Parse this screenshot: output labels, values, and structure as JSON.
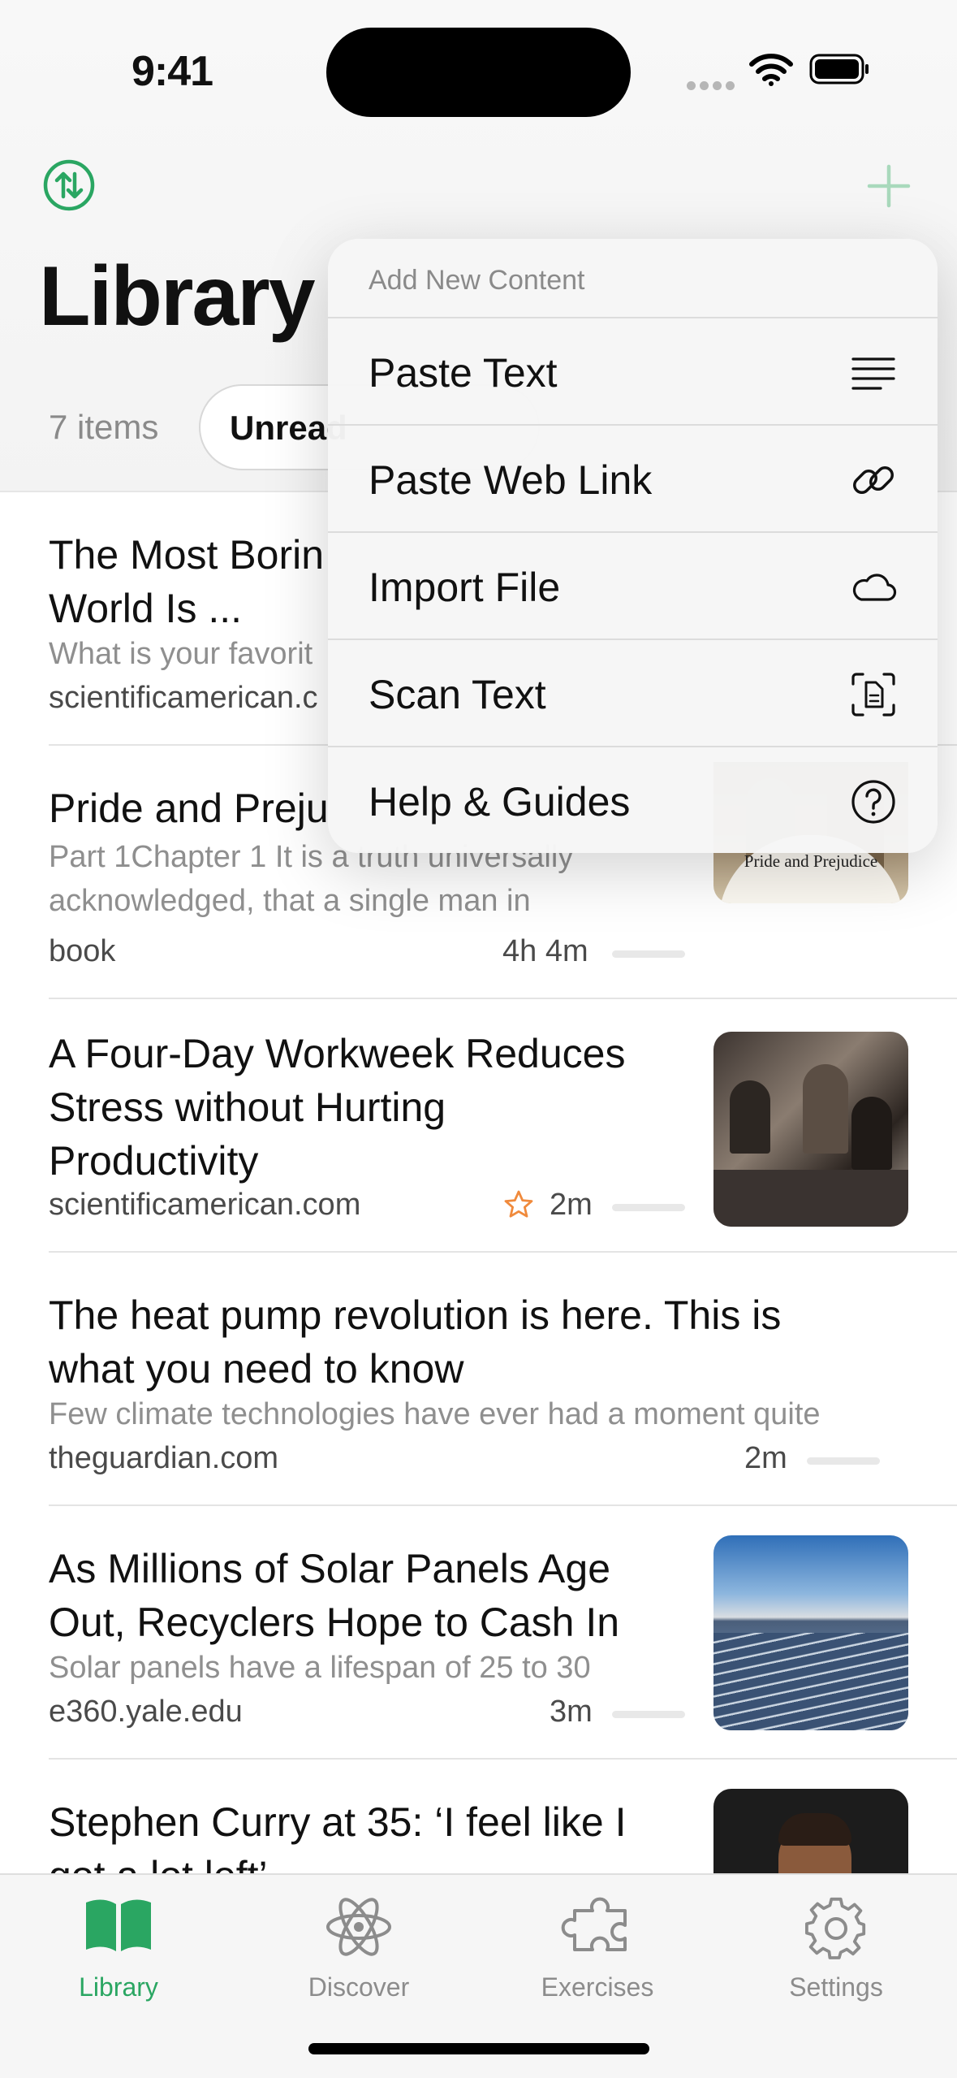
{
  "status": {
    "time": "9:41"
  },
  "header": {
    "title": "Library",
    "count": "7 items",
    "filter_chip": "Unread"
  },
  "menu": {
    "heading": "Add New Content",
    "items": [
      {
        "label": "Paste Text",
        "icon": "text-lines-icon"
      },
      {
        "label": "Paste Web Link",
        "icon": "link-icon"
      },
      {
        "label": "Import File",
        "icon": "cloud-icon"
      },
      {
        "label": "Scan Text",
        "icon": "scan-document-icon"
      },
      {
        "label": "Help & Guides",
        "icon": "question-circle-icon"
      }
    ]
  },
  "items": [
    {
      "title_l1": "The Most Borin",
      "title_l2": "World Is ...",
      "desc": "What is your favorit",
      "source": "scientificamerican.c"
    },
    {
      "title_l1": "Pride and Preju",
      "desc_l1": "Part 1Chapter 1 It is a truth universally",
      "desc_l2": "acknowledged, that a single man in",
      "source": "book",
      "time": "4h 4m",
      "progress": 0,
      "thumb_caption": "Pride and Prejudice"
    },
    {
      "title_l1": "A Four-Day Workweek Reduces",
      "title_l2": "Stress without Hurting",
      "title_l3": "Productivity",
      "source": "scientificamerican.com",
      "time": "2m",
      "starred": true,
      "progress": 0
    },
    {
      "title_l1": "The heat pump revolution is here. This is",
      "title_l2": "what you need to know",
      "desc": "Few climate technologies have ever had a moment quite",
      "source": "theguardian.com",
      "time": "2m",
      "progress": 0
    },
    {
      "title_l1": "As Millions of Solar Panels Age",
      "title_l2": "Out, Recyclers Hope to Cash In",
      "desc": "Solar panels have a lifespan of 25 to 30",
      "source": "e360.yale.edu",
      "time": "3m",
      "progress": 0
    },
    {
      "title_l1": "Stephen Curry at 35: ‘I feel like I",
      "title_l2": "got a lot left’"
    }
  ],
  "tabs": [
    {
      "label": "Library",
      "icon": "book-icon",
      "active": true
    },
    {
      "label": "Discover",
      "icon": "atom-icon"
    },
    {
      "label": "Exercises",
      "icon": "puzzle-icon"
    },
    {
      "label": "Settings",
      "icon": "gear-icon"
    }
  ],
  "colors": {
    "accent": "#2aa662",
    "star": "#f08a3c"
  }
}
